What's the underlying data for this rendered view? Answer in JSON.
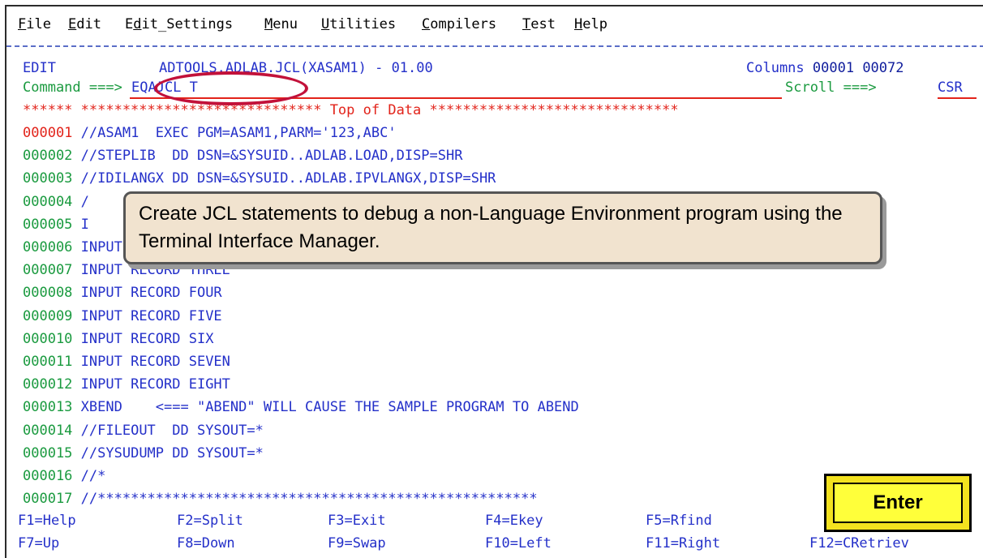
{
  "menu": [
    "File",
    "Edit",
    "Edit_Settings",
    "Menu",
    "Utilities",
    "Compilers",
    "Test",
    "Help"
  ],
  "header": {
    "mode": "EDIT",
    "dataset": "ADTOOLS.ADLAB.JCL(XASAM1) - 01.00",
    "columns_label": "Columns",
    "columns_value": "00001 00072"
  },
  "command": {
    "label": "Command ===>",
    "value": "EQAJCL T",
    "scroll_label": "Scroll ===>",
    "scroll_value": "CSR"
  },
  "top_of_data": "****** ***************************** Top of Data ******************************",
  "lines": [
    {
      "num": "000001",
      "text": "//ASAM1  EXEC PGM=ASAM1,PARM='123,ABC'"
    },
    {
      "num": "000002",
      "text": "//STEPLIB  DD DSN=&SYSUID..ADLAB.LOAD,DISP=SHR"
    },
    {
      "num": "000003",
      "text": "//IDILANGX DD DSN=&SYSUID..ADLAB.IPVLANGX,DISP=SHR"
    },
    {
      "num": "000004",
      "text": "/"
    },
    {
      "num": "000005",
      "text": "I"
    },
    {
      "num": "000006",
      "text": "INPUT RECORD TWO"
    },
    {
      "num": "000007",
      "text": "INPUT RECORD THREE"
    },
    {
      "num": "000008",
      "text": "INPUT RECORD FOUR"
    },
    {
      "num": "000009",
      "text": "INPUT RECORD FIVE"
    },
    {
      "num": "000010",
      "text": "INPUT RECORD SIX"
    },
    {
      "num": "000011",
      "text": "INPUT RECORD SEVEN"
    },
    {
      "num": "000012",
      "text": "INPUT RECORD EIGHT"
    },
    {
      "num": "000013",
      "text": "XBEND    <=== \"ABEND\" WILL CAUSE THE SAMPLE PROGRAM TO ABEND"
    },
    {
      "num": "000014",
      "text": "//FILEOUT  DD SYSOUT=*"
    },
    {
      "num": "000015",
      "text": "//SYSUDUMP DD SYSOUT=*"
    },
    {
      "num": "000016",
      "text": "//*"
    },
    {
      "num": "000017",
      "text": "//*****************************************************"
    }
  ],
  "callout": "Create JCL statements to debug a non-Language Environment program using the Terminal Interface Manager.",
  "enter_label": "Enter",
  "fkeys_row1": [
    "F1=Help",
    "F2=Split",
    "F3=Exit",
    "F4=Ekey",
    "F5=Rfind"
  ],
  "fkeys_row2": [
    "F7=Up",
    "F8=Down",
    "F9=Swap",
    "F10=Left",
    "F11=Right",
    "F12=CRetriev"
  ],
  "colors": {
    "accent_red": "#e2231a",
    "green": "#1a9a3f",
    "blue": "#2430c9",
    "callout_bg": "#f1e3cf",
    "enter_bg": "#ffff3a"
  }
}
